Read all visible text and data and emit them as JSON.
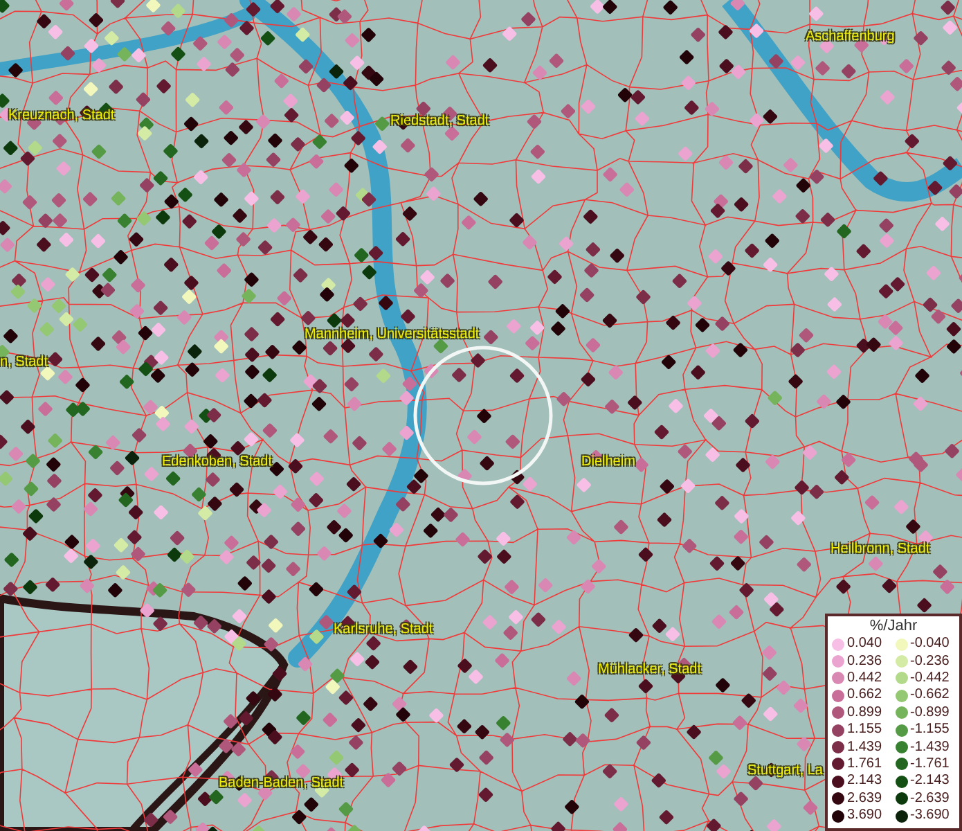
{
  "map": {
    "place_labels": [
      {
        "text": "Kreuznach, Stadt"
      },
      {
        "text": "Riedstadt, Stadt"
      },
      {
        "text": "Aschaffenburg"
      },
      {
        "text": "n, Stadt"
      },
      {
        "text": "Mannheim, Universitätsstadt"
      },
      {
        "text": "Edenkoben, Stadt"
      },
      {
        "text": "Dielheim"
      },
      {
        "text": "Heilbronn, Stadt"
      },
      {
        "text": "Karlsruhe, Stadt"
      },
      {
        "text": "Mühlacker, Stadt"
      },
      {
        "text": "Baden-Baden, Stadt"
      },
      {
        "text": "Stuttgart, La"
      }
    ]
  },
  "legend": {
    "title": "%/Jahr",
    "positive": [
      {
        "label": "0.040",
        "color": "#f7bfe6"
      },
      {
        "label": "0.236",
        "color": "#eba3d0"
      },
      {
        "label": "0.442",
        "color": "#d987b3"
      },
      {
        "label": "0.662",
        "color": "#c86e98"
      },
      {
        "label": "0.899",
        "color": "#b0587c"
      },
      {
        "label": "1.155",
        "color": "#954262"
      },
      {
        "label": "1.439",
        "color": "#7c2d48"
      },
      {
        "label": "1.761",
        "color": "#631a30"
      },
      {
        "label": "2.143",
        "color": "#4b0e1e"
      },
      {
        "label": "2.639",
        "color": "#340711"
      },
      {
        "label": "3.690",
        "color": "#210308"
      }
    ],
    "negative": [
      {
        "label": "-0.040",
        "color": "#f2f7bc"
      },
      {
        "label": "-0.236",
        "color": "#d4eba5"
      },
      {
        "label": "-0.442",
        "color": "#b2da8a"
      },
      {
        "label": "-0.662",
        "color": "#94c873"
      },
      {
        "label": "-0.899",
        "color": "#76b45c"
      },
      {
        "label": "-1.155",
        "color": "#559b45"
      },
      {
        "label": "-1.439",
        "color": "#388130"
      },
      {
        "label": "-1.761",
        "color": "#22661f"
      },
      {
        "label": "-2.143",
        "color": "#145014"
      },
      {
        "label": "-2.639",
        "color": "#0c3a0c"
      },
      {
        "label": "-3.690",
        "color": "#0b220b"
      }
    ]
  }
}
